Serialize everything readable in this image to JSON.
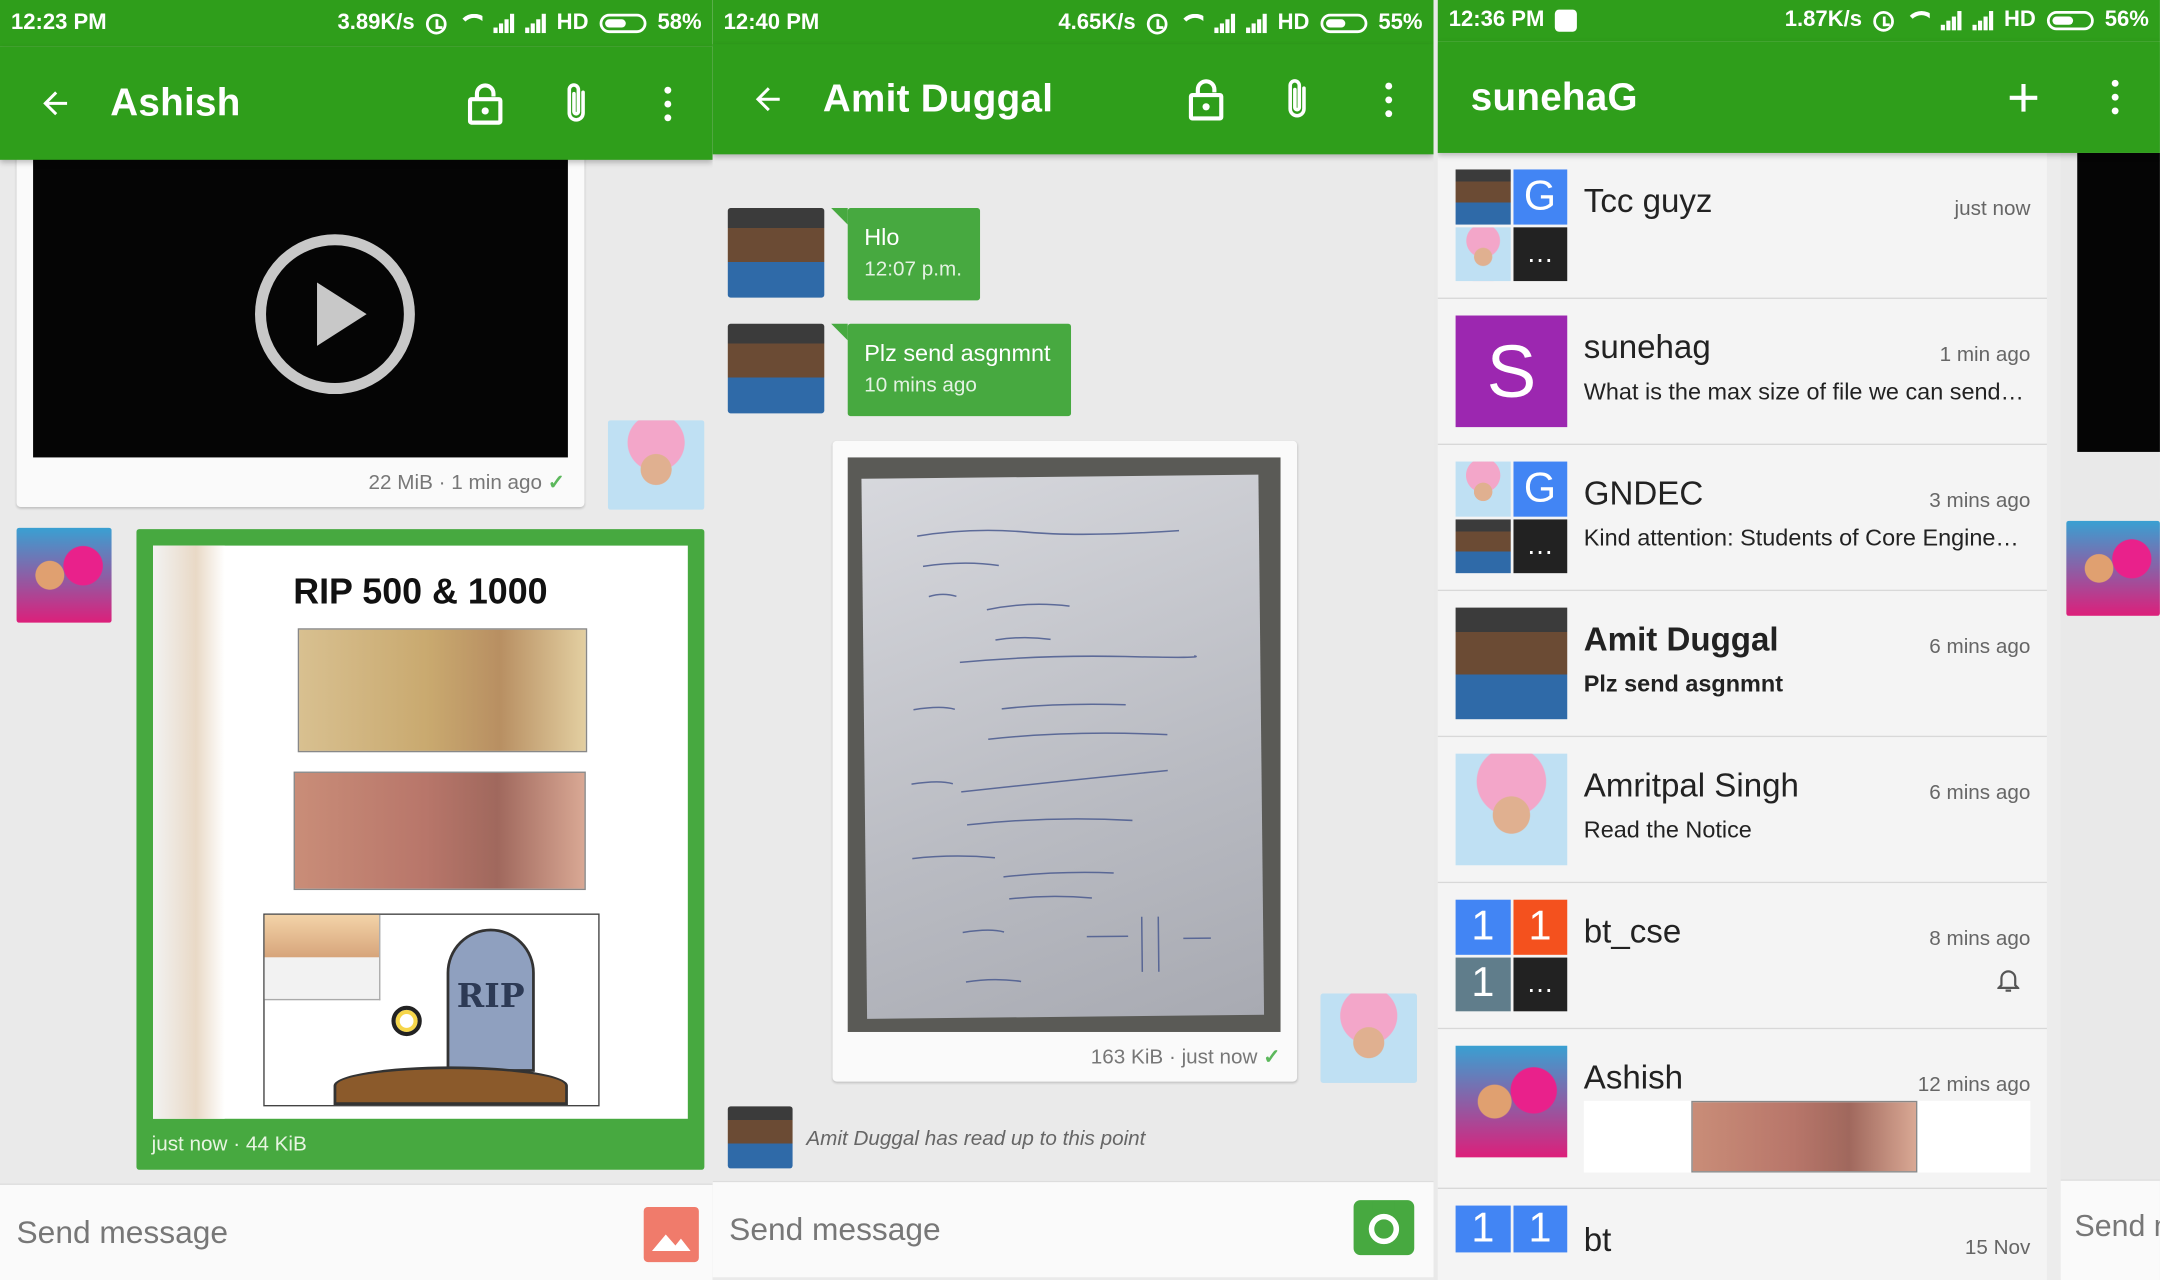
{
  "panel1": {
    "status": {
      "time": "12:23 PM",
      "speed": "3.89K/s",
      "hd": "HD",
      "battery": "58%",
      "battery_level": 0.58
    },
    "title": "Ashish",
    "video_meta": "22 MiB · 1 min ago",
    "poster_title": "RIP 500 & 1000",
    "poster_rip": "RIP",
    "image_meta": "just now · 44 KiB",
    "input_placeholder": "Send message"
  },
  "panel2": {
    "status": {
      "time": "12:40 PM",
      "speed": "4.65K/s",
      "hd": "HD",
      "battery": "55%",
      "battery_level": 0.55
    },
    "title": "Amit Duggal",
    "messages": [
      {
        "text": "Hlo",
        "time": "12:07 p.m."
      },
      {
        "text": "Plz send asgnmnt",
        "time": "10 mins ago"
      }
    ],
    "image_meta": "163 KiB · just now",
    "read_receipt": "Amit Duggal has read up to this point",
    "input_placeholder": "Send message"
  },
  "panel3": {
    "status": {
      "time": "12:36 PM",
      "speed": "1.87K/s",
      "hd": "HD",
      "battery": "56%",
      "battery_level": 0.56
    },
    "title": "sunehaG",
    "chats": [
      {
        "name": "Tcc guyz",
        "snippet": "",
        "time": "just now"
      },
      {
        "name": "sunehag",
        "snippet": "What is the max size of file we can send…",
        "time": "1 min ago",
        "letter": "S"
      },
      {
        "name": "GNDEC",
        "snippet": "Kind attention: Students of Core Engine…",
        "time": "3 mins ago"
      },
      {
        "name": "Amit Duggal",
        "snippet": "Plz send asgnmnt",
        "time": "6 mins ago"
      },
      {
        "name": "Amritpal Singh",
        "snippet": "Read the Notice",
        "time": "6 mins ago"
      },
      {
        "name": "bt_cse",
        "snippet": "",
        "time": "8 mins ago"
      },
      {
        "name": "Ashish",
        "snippet": "",
        "time": "12 mins ago"
      },
      {
        "name": "bt",
        "snippet": "",
        "time": "15 Nov"
      }
    ],
    "group_letters": {
      "g": "G",
      "one": "1",
      "more": "…"
    },
    "side_input": "Send m"
  },
  "colors": {
    "primary": "#2f9e1b",
    "bubble": "#47a940",
    "purple": "#9c27b0",
    "blue": "#4285f4",
    "red": "#f4511e",
    "slate": "#607d8b"
  },
  "icons": [
    "arrow-back-icon",
    "lock-icon",
    "attachment-icon",
    "more-vert-icon",
    "image-icon",
    "camera-icon",
    "add-icon",
    "bell-icon",
    "play-icon"
  ]
}
